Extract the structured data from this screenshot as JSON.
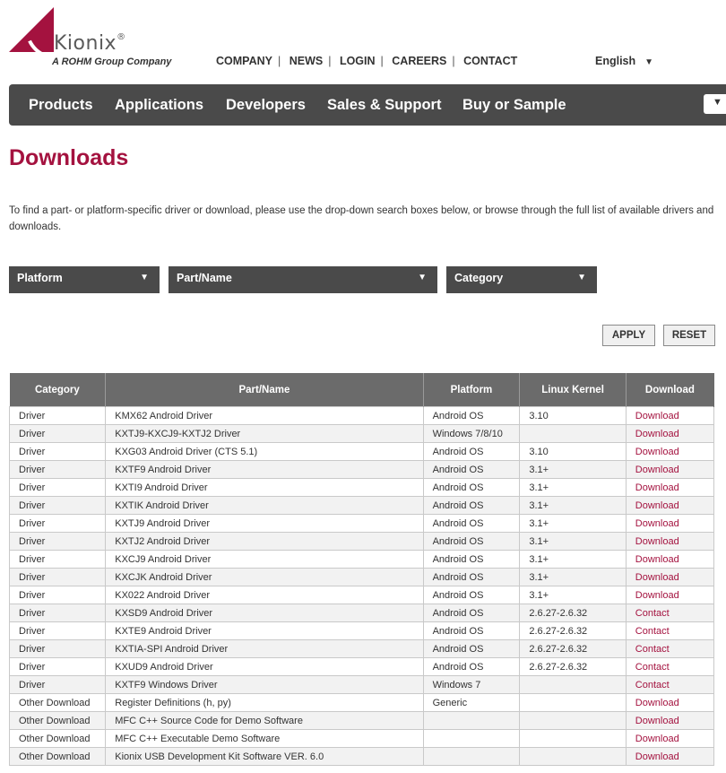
{
  "brand": {
    "name": "Kionix",
    "tagline": "A ROHM Group Company",
    "color": "#a4123f"
  },
  "topnav": [
    "COMPANY",
    "NEWS",
    "LOGIN",
    "CAREERS",
    "CONTACT"
  ],
  "language": "English",
  "menu": [
    "Products",
    "Applications",
    "Developers",
    "Sales & Support",
    "Buy or Sample"
  ],
  "page": {
    "title": "Downloads",
    "intro": "To find a part- or platform-specific driver or download, please use the drop-down search boxes below, or browse through the full list of available drivers and downloads."
  },
  "filters": {
    "platform": "Platform",
    "part": "Part/Name",
    "category": "Category"
  },
  "buttons": {
    "apply": "APPLY",
    "reset": "RESET"
  },
  "table": {
    "headers": [
      "Category",
      "Part/Name",
      "Platform",
      "Linux Kernel",
      "Download"
    ],
    "rows": [
      [
        "Driver",
        "KMX62 Android Driver",
        "Android OS",
        "3.10",
        "Download"
      ],
      [
        "Driver",
        "KXTJ9-KXCJ9-KXTJ2 Driver",
        "Windows 7/8/10",
        "",
        "Download"
      ],
      [
        "Driver",
        "KXG03 Android Driver (CTS 5.1)",
        "Android OS",
        "3.10",
        "Download"
      ],
      [
        "Driver",
        "KXTF9 Android Driver",
        "Android OS",
        "3.1+",
        "Download"
      ],
      [
        "Driver",
        "KXTI9 Android Driver",
        "Android OS",
        "3.1+",
        "Download"
      ],
      [
        "Driver",
        "KXTIK Android Driver",
        "Android OS",
        "3.1+",
        "Download"
      ],
      [
        "Driver",
        "KXTJ9 Android Driver",
        "Android OS",
        "3.1+",
        "Download"
      ],
      [
        "Driver",
        "KXTJ2 Android Driver",
        "Android OS",
        "3.1+",
        "Download"
      ],
      [
        "Driver",
        "KXCJ9 Android Driver",
        "Android OS",
        "3.1+",
        "Download"
      ],
      [
        "Driver",
        "KXCJK Android Driver",
        "Android OS",
        "3.1+",
        "Download"
      ],
      [
        "Driver",
        "KX022 Android Driver",
        "Android OS",
        "3.1+",
        "Download"
      ],
      [
        "Driver",
        "KXSD9 Android Driver",
        "Android OS",
        "2.6.27-2.6.32",
        "Contact"
      ],
      [
        "Driver",
        "KXTE9 Android Driver",
        "Android OS",
        "2.6.27-2.6.32",
        "Contact"
      ],
      [
        "Driver",
        "KXTIA-SPI Android Driver",
        "Android OS",
        "2.6.27-2.6.32",
        "Contact"
      ],
      [
        "Driver",
        "KXUD9 Android Driver",
        "Android OS",
        "2.6.27-2.6.32",
        "Contact"
      ],
      [
        "Driver",
        "KXTF9 Windows Driver",
        "Windows 7",
        "",
        "Contact"
      ],
      [
        "Other Download",
        "Register Definitions (h, py)",
        "Generic",
        "",
        "Download"
      ],
      [
        "Other Download",
        "MFC C++ Source Code for Demo Software",
        "",
        "",
        "Download"
      ],
      [
        "Other Download",
        "MFC C++ Executable Demo Software",
        "",
        "",
        "Download"
      ],
      [
        "Other Download",
        "Kionix USB Development Kit Software VER. 6.0",
        "",
        "",
        "Download"
      ]
    ]
  }
}
